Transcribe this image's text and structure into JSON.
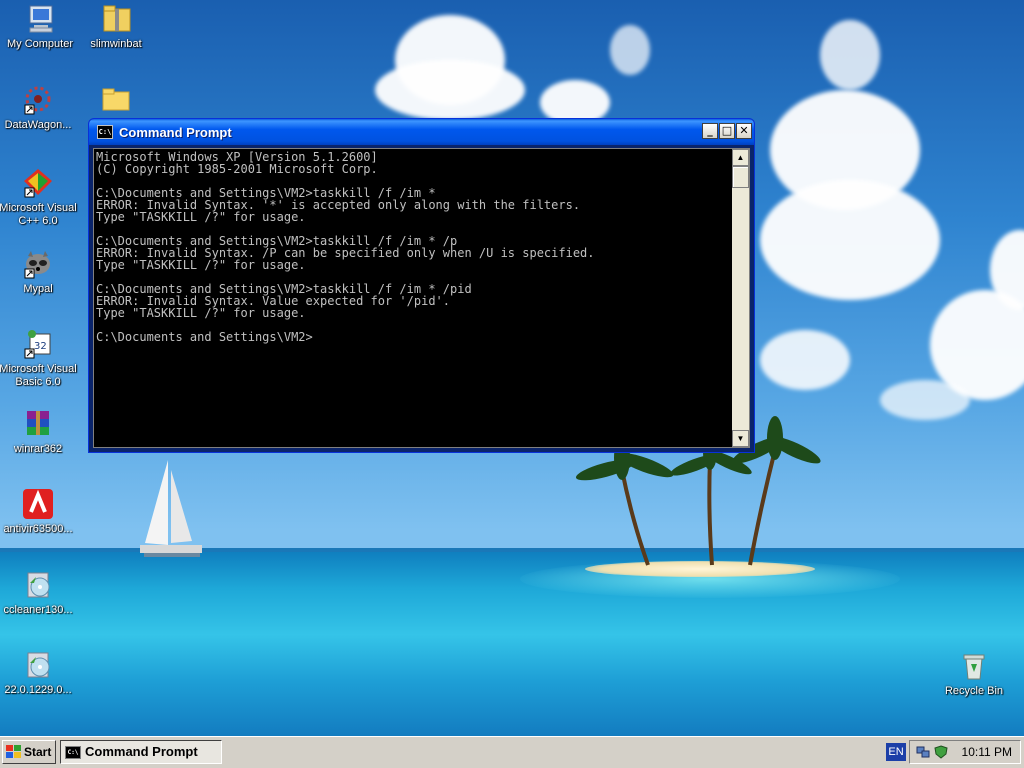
{
  "desktop": {
    "icons": [
      {
        "label": "My Computer"
      },
      {
        "label": "slimwinbat"
      },
      {
        "label": "DataWagon..."
      },
      {
        "label": ""
      },
      {
        "label": "Microsoft Visual C++ 6.0"
      },
      {
        "label": "Mypal"
      },
      {
        "label": "Microsoft Visual Basic 6.0"
      },
      {
        "label": "winrar362"
      },
      {
        "label": "antivir63500..."
      },
      {
        "label": "ccleaner130..."
      },
      {
        "label": "22.0.1229.0..."
      },
      {
        "label": "Recycle Bin"
      }
    ]
  },
  "window": {
    "title": "Command Prompt",
    "icon_text": "C:\\",
    "minimize": "_",
    "maximize": "□",
    "close": "✕",
    "console": "Microsoft Windows XP [Version 5.1.2600]\n(C) Copyright 1985-2001 Microsoft Corp.\n\nC:\\Documents and Settings\\VM2>taskkill /f /im *\nERROR: Invalid Syntax. '*' is accepted only along with the filters.\nType \"TASKKILL /?\" for usage.\n\nC:\\Documents and Settings\\VM2>taskkill /f /im * /p\nERROR: Invalid Syntax. /P can be specified only when /U is specified.\nType \"TASKKILL /?\" for usage.\n\nC:\\Documents and Settings\\VM2>taskkill /f /im * /pid\nERROR: Invalid Syntax. Value expected for '/pid'.\nType \"TASKKILL /?\" for usage.\n\nC:\\Documents and Settings\\VM2>",
    "scroll_up": "▲",
    "scroll_down": "▼"
  },
  "taskbar": {
    "start_label": "Start",
    "task_label": "Command Prompt",
    "task_icon_text": "C:\\",
    "language": "EN",
    "clock": "10:11 PM"
  },
  "colors": {
    "console_bg": "#000000",
    "console_text": "#c0c0c0",
    "titlebar": "#0054e3",
    "taskbar": "#d4d0c8"
  }
}
